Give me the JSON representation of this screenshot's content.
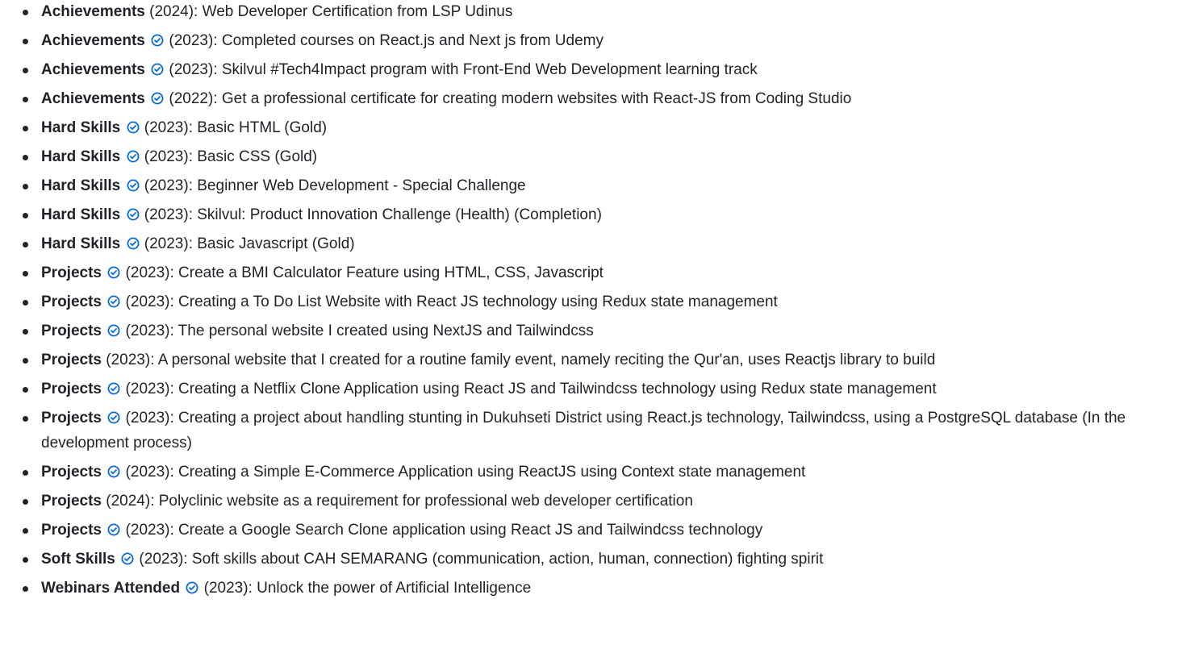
{
  "items": [
    {
      "category": "Achievements",
      "verified": false,
      "year": "(2024)",
      "description": ": Web Developer Certification from LSP Udinus"
    },
    {
      "category": "Achievements",
      "verified": true,
      "year": "(2023)",
      "description": ": Completed courses on React.js and Next js from Udemy"
    },
    {
      "category": "Achievements",
      "verified": true,
      "year": "(2023)",
      "description": ": Skilvul #Tech4Impact program with Front-End Web Development learning track"
    },
    {
      "category": "Achievements",
      "verified": true,
      "year": "(2022)",
      "description": ": Get a professional certificate for creating modern websites with React-JS from Coding Studio"
    },
    {
      "category": "Hard Skills",
      "verified": true,
      "year": "(2023)",
      "description": ": Basic HTML (Gold)"
    },
    {
      "category": "Hard Skills",
      "verified": true,
      "year": "(2023)",
      "description": ": Basic CSS (Gold)"
    },
    {
      "category": "Hard Skills",
      "verified": true,
      "year": "(2023)",
      "description": ": Beginner Web Development - Special Challenge"
    },
    {
      "category": "Hard Skills",
      "verified": true,
      "year": "(2023)",
      "description": ": Skilvul: Product Innovation Challenge (Health) (Completion)"
    },
    {
      "category": "Hard Skills",
      "verified": true,
      "year": "(2023)",
      "description": ": Basic Javascript (Gold)"
    },
    {
      "category": "Projects",
      "verified": true,
      "year": "(2023)",
      "description": ": Create a BMI Calculator Feature using HTML, CSS, Javascript"
    },
    {
      "category": "Projects",
      "verified": true,
      "year": "(2023)",
      "description": ": Creating a To Do List Website with React JS technology using Redux state management"
    },
    {
      "category": "Projects",
      "verified": true,
      "year": "(2023)",
      "description": ": The personal website I created using NextJS and Tailwindcss"
    },
    {
      "category": "Projects",
      "verified": false,
      "year": "(2023)",
      "description": ": A personal website that I created for a routine family event, namely reciting the Qur'an, uses Reactjs library to build"
    },
    {
      "category": "Projects",
      "verified": true,
      "year": "(2023)",
      "description": ": Creating a Netflix Clone Application using React JS and Tailwindcss technology using Redux state management"
    },
    {
      "category": "Projects",
      "verified": true,
      "year": "(2023)",
      "description": ": Creating a project about handling stunting in Dukuhseti District using React.js technology, Tailwindcss, using a PostgreSQL database (In the development process)"
    },
    {
      "category": "Projects",
      "verified": true,
      "year": "(2023)",
      "description": ": Creating a Simple E-Commerce Application using ReactJS using Context state management"
    },
    {
      "category": "Projects",
      "verified": false,
      "year": "(2024)",
      "description": ": Polyclinic website as a requirement for professional web developer certification"
    },
    {
      "category": "Projects",
      "verified": true,
      "year": "(2023)",
      "description": ": Create a Google Search Clone application using React JS and Tailwindcss technology"
    },
    {
      "category": "Soft Skills",
      "verified": true,
      "year": "(2023)",
      "description": ": Soft skills about CAH SEMARANG (communication, action, human, connection) fighting spirit"
    },
    {
      "category": "Webinars Attended",
      "verified": true,
      "year": "(2023)",
      "description": ": Unlock the power of Artificial Intelligence"
    }
  ],
  "colors": {
    "text": "#1f2328",
    "check_icon": "#0969da"
  },
  "icons": {
    "verified": "check-circle-icon"
  }
}
